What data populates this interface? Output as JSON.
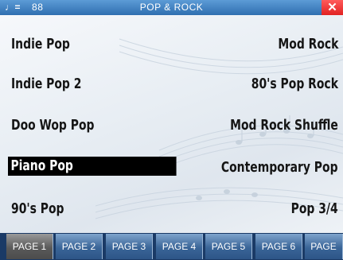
{
  "header": {
    "tempo_symbol": "♩=",
    "tempo_value": "88",
    "title": "POP & ROCK",
    "close_glyph": "✕"
  },
  "styles": {
    "left": [
      "Indie Pop",
      "Indie Pop 2",
      "Doo Wop Pop",
      "Piano Pop",
      "90's Pop"
    ],
    "right": [
      "Mod Rock",
      "80's Pop Rock",
      "Mod Rock Shuffle",
      "Contemporary Pop",
      "Pop 3/4"
    ],
    "selected": "Piano Pop"
  },
  "pages": {
    "tabs": [
      "PAGE 1",
      "PAGE 2",
      "PAGE 3",
      "PAGE 4",
      "PAGE 5",
      "PAGE 6",
      "PAGE"
    ],
    "active": "PAGE 1"
  },
  "colors": {
    "title_bar": "#3f82c4",
    "close_button": "#e12121",
    "selection": "#000000",
    "tab": "#3a6598",
    "active_tab": "#5a5a5a"
  }
}
